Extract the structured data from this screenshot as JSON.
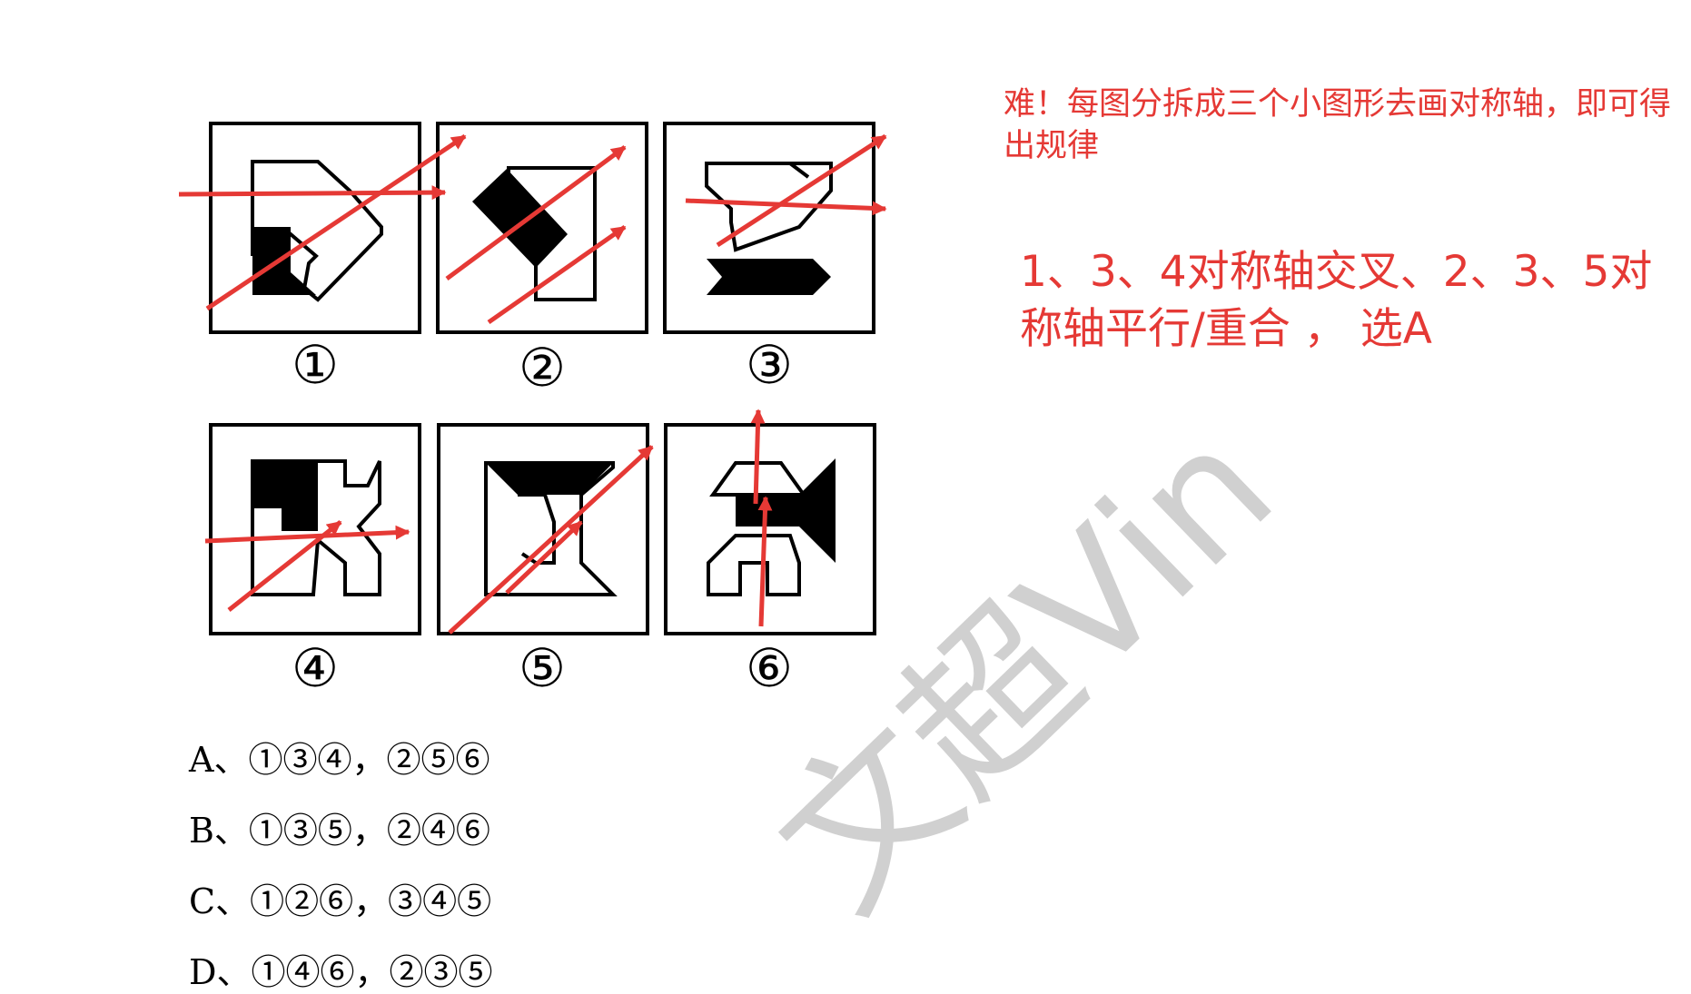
{
  "figure": {
    "labels": [
      "①",
      "②",
      "③",
      "④",
      "⑤",
      "⑥"
    ]
  },
  "notes": {
    "hint": "难！每图分拆成三个小图形去画对称轴，即可得出规律",
    "answer": "1、3、4对称轴交叉、2、3、5对称轴平行/重合 ， 选A"
  },
  "options": [
    "A、①③④，②⑤⑥",
    "B、①③⑤，②④⑥",
    "C、①②⑥，③④⑤",
    "D、①④⑥，②③⑤"
  ],
  "watermark": "文超Vin",
  "colors": {
    "annotation": "#e53935",
    "figure": "#000000"
  }
}
